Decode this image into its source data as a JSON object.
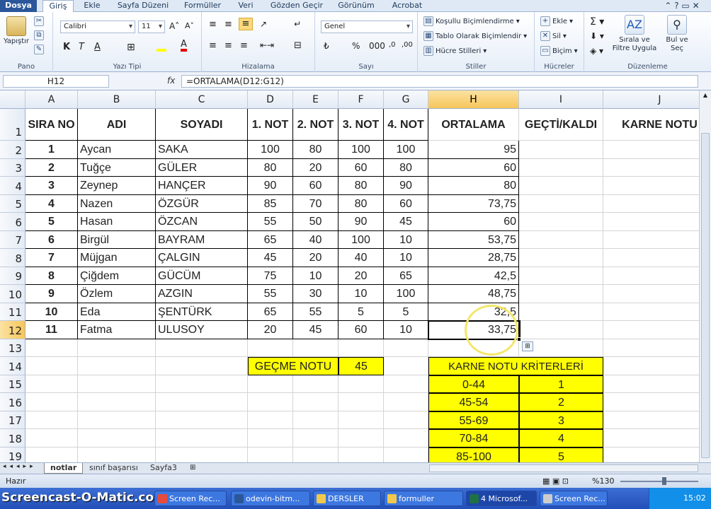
{
  "tabs": [
    "Dosya",
    "Giriş",
    "Ekle",
    "Sayfa Düzeni",
    "Formüller",
    "Veri",
    "Gözden Geçir",
    "Görünüm",
    "Acrobat"
  ],
  "ribbon": {
    "paste": "Yapıştır",
    "clipboard": "Pano",
    "font_name": "Calibri",
    "font_size": "11",
    "font_group": "Yazı Tipi",
    "align_group": "Hizalama",
    "number_format": "Genel",
    "number_group": "Sayı",
    "cond_format": "Koşullu Biçimlendirme",
    "table_format": "Tablo Olarak Biçimlendir",
    "cell_styles": "Hücre Stilleri",
    "styles_group": "Stiller",
    "insert": "Ekle",
    "delete": "Sil",
    "format": "Biçim",
    "cells_group": "Hücreler",
    "sort_filter": "Sırala ve Filtre Uygula",
    "find_select": "Bul ve Seç",
    "editing_group": "Düzenleme"
  },
  "formula_bar": {
    "name_box": "H12",
    "fx": "fx",
    "formula": "=ORTALAMA(D12:G12)"
  },
  "columns": [
    "A",
    "B",
    "C",
    "D",
    "E",
    "F",
    "G",
    "H",
    "I",
    "J"
  ],
  "rows": [
    "1",
    "2",
    "3",
    "4",
    "5",
    "6",
    "7",
    "8",
    "9",
    "10",
    "11",
    "12",
    "13",
    "14",
    "15",
    "16",
    "17",
    "18",
    "19"
  ],
  "headers": [
    "SIRA NO",
    "ADI",
    "SOYADI",
    "1. NOT",
    "2. NOT",
    "3. NOT",
    "4. NOT",
    "ORTALAMA",
    "GEÇTİ/KALDI",
    "KARNE NOTU"
  ],
  "students": [
    [
      "1",
      "Aycan",
      "SAKA",
      "100",
      "80",
      "100",
      "100",
      "95"
    ],
    [
      "2",
      "Tuğçe",
      "GÜLER",
      "80",
      "20",
      "60",
      "80",
      "60"
    ],
    [
      "3",
      "Zeynep",
      "HANÇER",
      "90",
      "60",
      "80",
      "90",
      "80"
    ],
    [
      "4",
      "Nazen",
      "ÖZGÜR",
      "85",
      "70",
      "80",
      "60",
      "73,75"
    ],
    [
      "5",
      "Hasan",
      "ÖZCAN",
      "55",
      "50",
      "90",
      "45",
      "60"
    ],
    [
      "6",
      "Birgül",
      "BAYRAM",
      "65",
      "40",
      "100",
      "10",
      "53,75"
    ],
    [
      "7",
      "Müjgan",
      "ÇALGIN",
      "45",
      "20",
      "40",
      "10",
      "28,75"
    ],
    [
      "8",
      "Çiğdem",
      "GÜCÜM",
      "75",
      "10",
      "20",
      "65",
      "42,5"
    ],
    [
      "9",
      "Özlem",
      "AZGIN",
      "55",
      "30",
      "10",
      "100",
      "48,75"
    ],
    [
      "10",
      "Eda",
      "ŞENTÜRK",
      "65",
      "55",
      "5",
      "5",
      "32,5"
    ],
    [
      "11",
      "Fatma",
      "ULUSOY",
      "20",
      "45",
      "60",
      "10",
      "33,75"
    ]
  ],
  "pass_grade": {
    "label": "GEÇME NOTU",
    "value": "45"
  },
  "criteria": {
    "title": "KARNE NOTU KRİTERLERİ",
    "rows": [
      [
        "0-44",
        "1"
      ],
      [
        "45-54",
        "2"
      ],
      [
        "55-69",
        "3"
      ],
      [
        "70-84",
        "4"
      ],
      [
        "85-100",
        "5"
      ]
    ]
  },
  "sheets": [
    "notlar",
    "sınıf başarısı",
    "Sayfa3"
  ],
  "status": {
    "mode": "Hazır",
    "zoom": "%130"
  },
  "taskbar": {
    "watermark": "Screencast-O-Matic.com",
    "items": [
      "Screen Rec...",
      "odevin-bitm...",
      "DERSLER",
      "formuller",
      "4 Microsof...",
      "Screen Rec..."
    ],
    "clock": "15:02"
  },
  "colors": {
    "selection_header": "#f7c65a",
    "highlight": "#ffff00",
    "accent": "#2b579a"
  }
}
